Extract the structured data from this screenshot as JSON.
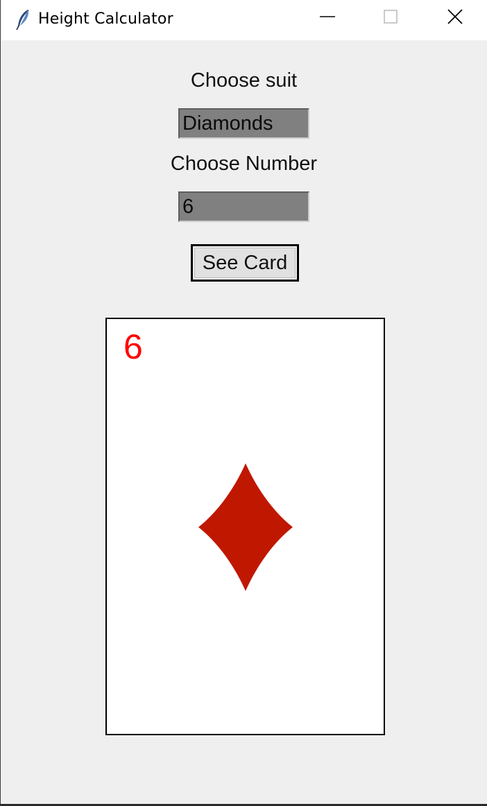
{
  "window": {
    "title": "Height Calculator"
  },
  "form": {
    "suit_label": "Choose suit",
    "suit_value": "Diamonds",
    "number_label": "Choose Number",
    "number_value": "6",
    "button_label": "See Card"
  },
  "card": {
    "rank": "6",
    "suit": "Diamonds",
    "suit_icon": "diamond-icon",
    "rank_color": "#ff0000",
    "suit_color": "#c01800"
  },
  "colors": {
    "field_background": "#808080",
    "window_background": "#efefef"
  }
}
